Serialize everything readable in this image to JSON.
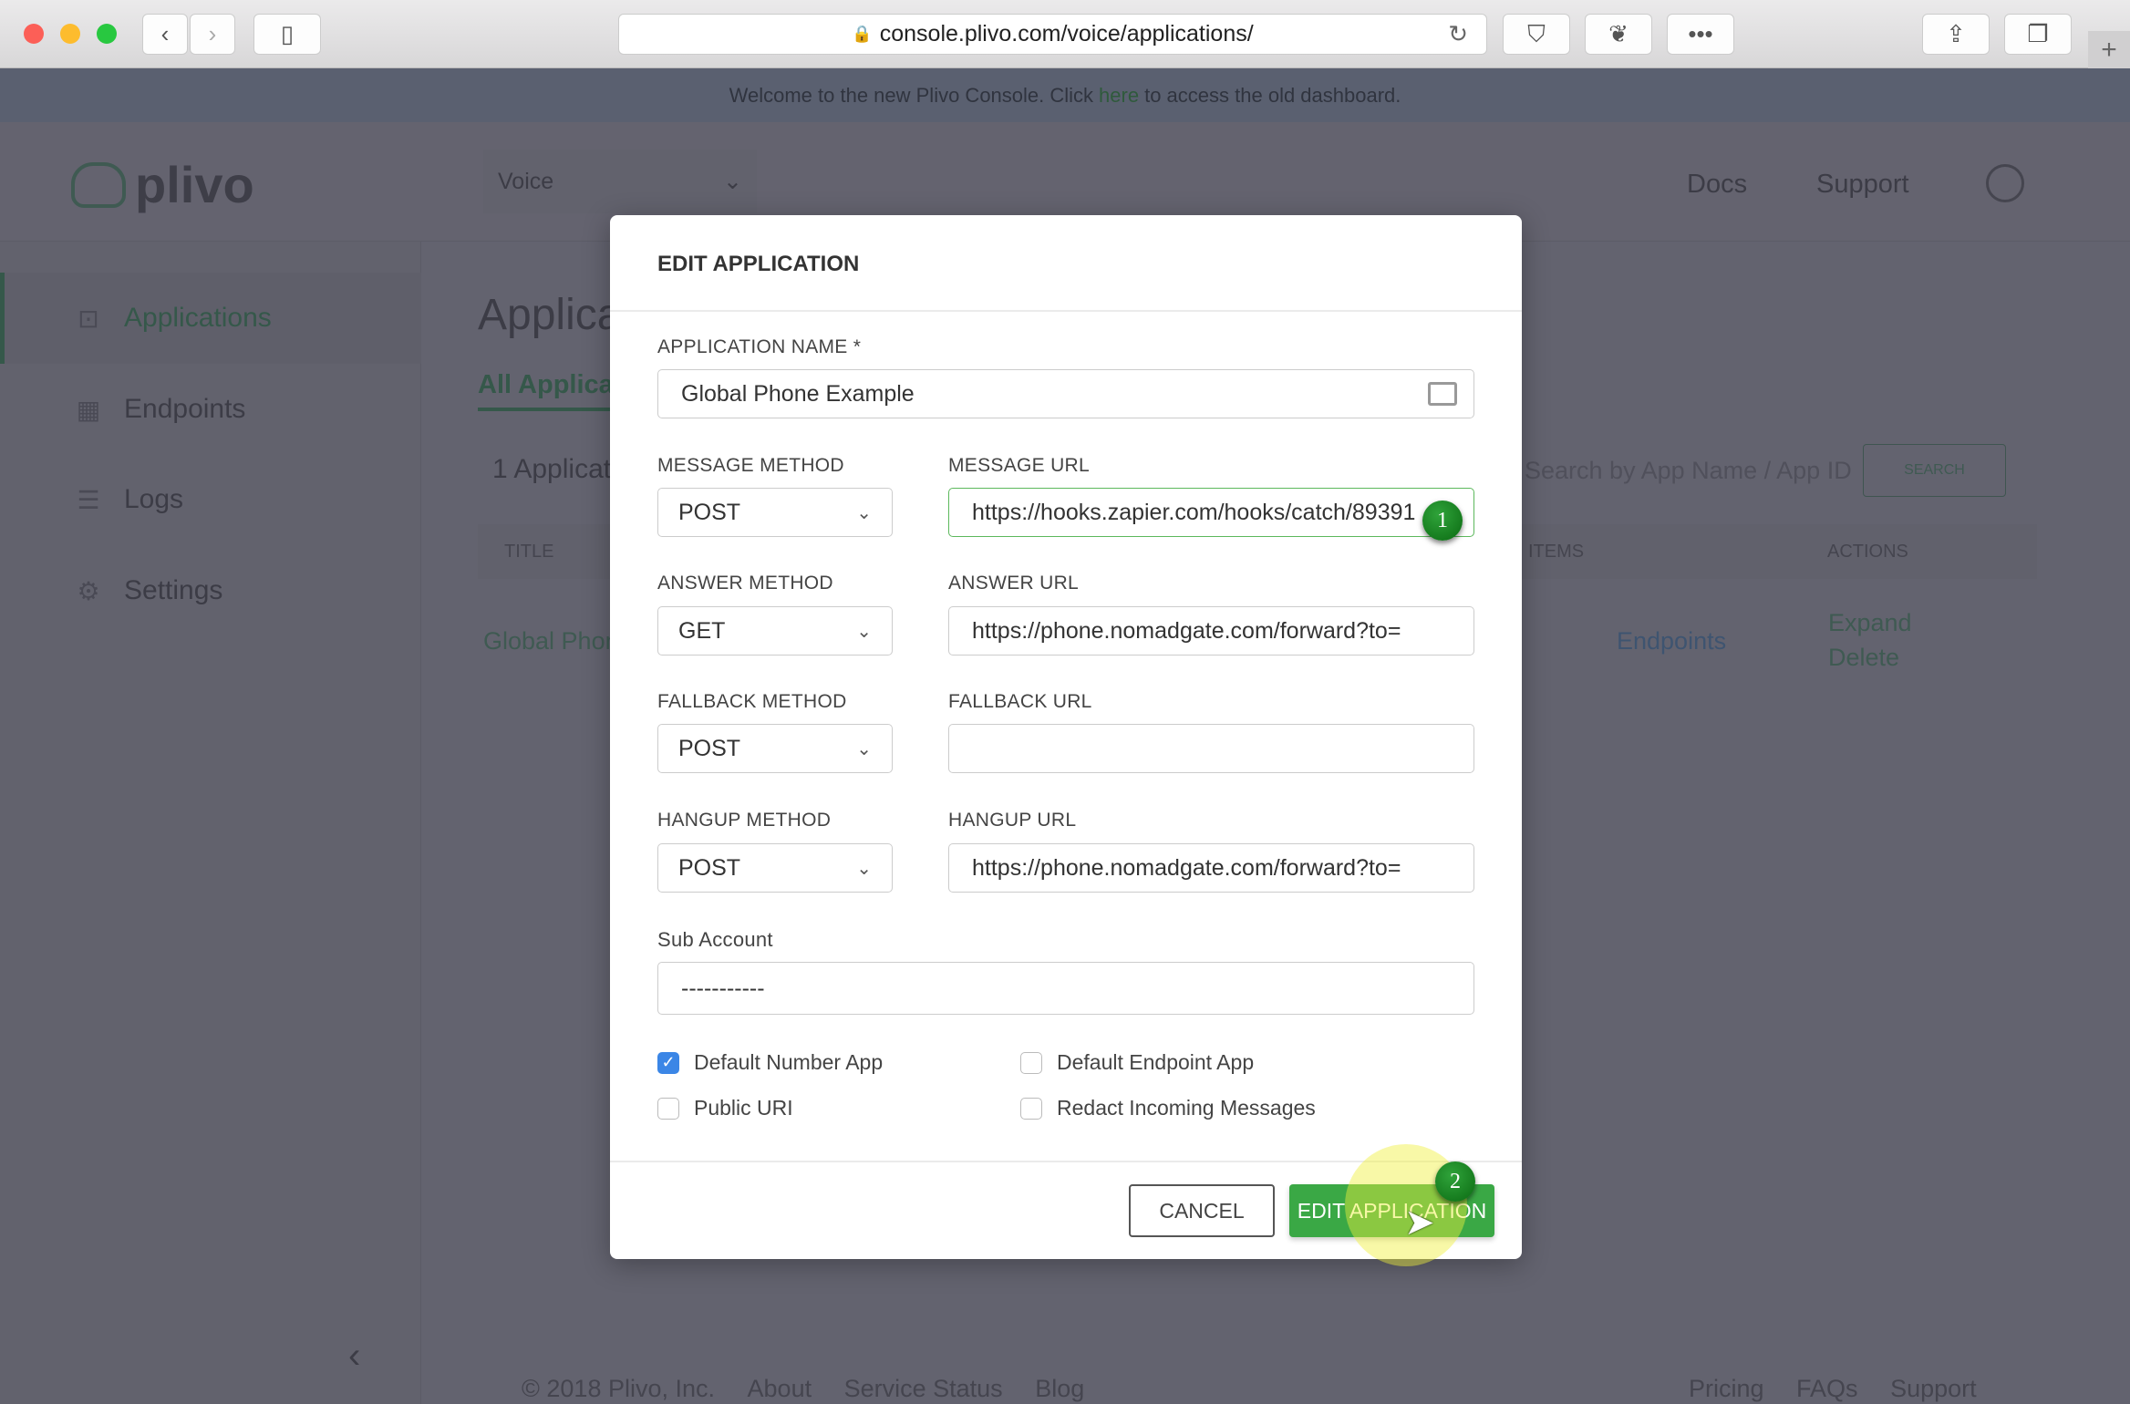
{
  "browser": {
    "url": "console.plivo.com/voice/applications/"
  },
  "banner": {
    "before": "Welcome to the new Plivo Console. Click",
    "link": "here",
    "after": "to access the old dashboard."
  },
  "header": {
    "logo": "plivo",
    "product": "Voice",
    "docs": "Docs",
    "support": "Support"
  },
  "sidebar": {
    "items": [
      {
        "label": "Applications",
        "icon": "terminal-icon",
        "active": true
      },
      {
        "label": "Endpoints",
        "icon": "grid-icon"
      },
      {
        "label": "Logs",
        "icon": "list-icon"
      },
      {
        "label": "Settings",
        "icon": "gear-icon"
      }
    ]
  },
  "main": {
    "title": "Applications",
    "tab": "All Applications",
    "count": "1 Applications",
    "search_placeholder": "Search by App Name / App ID",
    "search_button": "SEARCH",
    "columns": {
      "title": "TITLE",
      "items": "ITEMS",
      "actions": "ACTIONS"
    },
    "row": {
      "title": "Global Phone Example",
      "items": "Endpoints",
      "expand": "Expand",
      "delete": "Delete"
    }
  },
  "footer": {
    "copyright": "© 2018 Plivo, Inc.",
    "about": "About",
    "status": "Service Status",
    "blog": "Blog",
    "pricing": "Pricing",
    "faqs": "FAQs",
    "support": "Support"
  },
  "modal": {
    "title": "EDIT APPLICATION",
    "app_name_label": "APPLICATION NAME *",
    "app_name": "Global Phone Example",
    "message_method_label": "MESSAGE METHOD",
    "message_method": "POST",
    "message_url_label": "MESSAGE URL",
    "message_url": "https://hooks.zapier.com/hooks/catch/89391",
    "answer_method_label": "ANSWER METHOD",
    "answer_method": "GET",
    "answer_url_label": "ANSWER URL",
    "answer_url": "https://phone.nomadgate.com/forward?to=",
    "fallback_method_label": "FALLBACK METHOD",
    "fallback_method": "POST",
    "fallback_url_label": "FALLBACK URL",
    "fallback_url": "",
    "hangup_method_label": "HANGUP METHOD",
    "hangup_method": "POST",
    "hangup_url_label": "HANGUP URL",
    "hangup_url": "https://phone.nomadgate.com/forward?to=",
    "sub_account_label": "Sub Account",
    "sub_account": "-----------",
    "checkboxes": [
      {
        "label": "Default Number App",
        "checked": true
      },
      {
        "label": "Default Endpoint App",
        "checked": false
      },
      {
        "label": "Public URI",
        "checked": false
      },
      {
        "label": "Redact Incoming Messages",
        "checked": false
      }
    ],
    "cancel": "CANCEL",
    "submit": "EDIT APPLICATION"
  },
  "annotations": {
    "step1": "1",
    "step2": "2"
  },
  "colors": {
    "accent": "#3fae49",
    "checkbox": "#3b86e6",
    "badge": "#1a8a24"
  }
}
